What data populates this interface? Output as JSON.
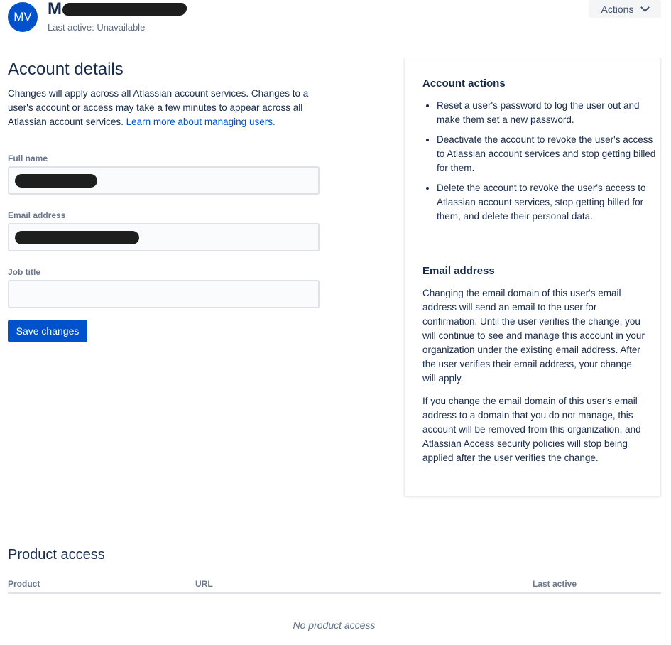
{
  "header": {
    "avatar_initials": "MV",
    "name_visible": "M",
    "last_active": "Last active: Unavailable",
    "actions_label": "Actions"
  },
  "account_details": {
    "title": "Account details",
    "intro_text": "Changes will apply across all Atlassian account services. Changes to a user's account or access may take a few minutes to appear across all Atlassian account services. ",
    "learn_more_link": "Learn more about managing users.",
    "fields": {
      "full_name_label": "Full name",
      "email_label": "Email address",
      "job_title_label": "Job title",
      "job_title_value": ""
    },
    "save_label": "Save changes"
  },
  "side_panel": {
    "account_actions_title": "Account actions",
    "actions": [
      "Reset a user's password to log the user out and make them set a new password.",
      "Deactivate the account to revoke the user's access to Atlassian account services and stop getting billed for them.",
      "Delete the account to revoke the user's access to Atlassian account services, stop getting billed for them, and delete their personal data."
    ],
    "email_title": "Email address",
    "email_paragraph_1": "Changing the email domain of this user's email address will send an email to the user for confirmation. Until the user verifies the change, you will continue to see and manage this account in your organization under the existing email address. After the user verifies their email address, your change will apply.",
    "email_paragraph_2": "If you change the email domain of this user's email address to a domain that you do not manage, this account will be removed from this organization, and Atlassian Access security policies will stop being applied after the user verifies the change."
  },
  "product_access": {
    "title": "Product access",
    "columns": [
      "Product",
      "URL",
      "Last active"
    ],
    "empty_text": "No product access"
  },
  "colors": {
    "primary": "#0052cc",
    "text": "#172b4d",
    "subtle_text": "#6b778c"
  }
}
